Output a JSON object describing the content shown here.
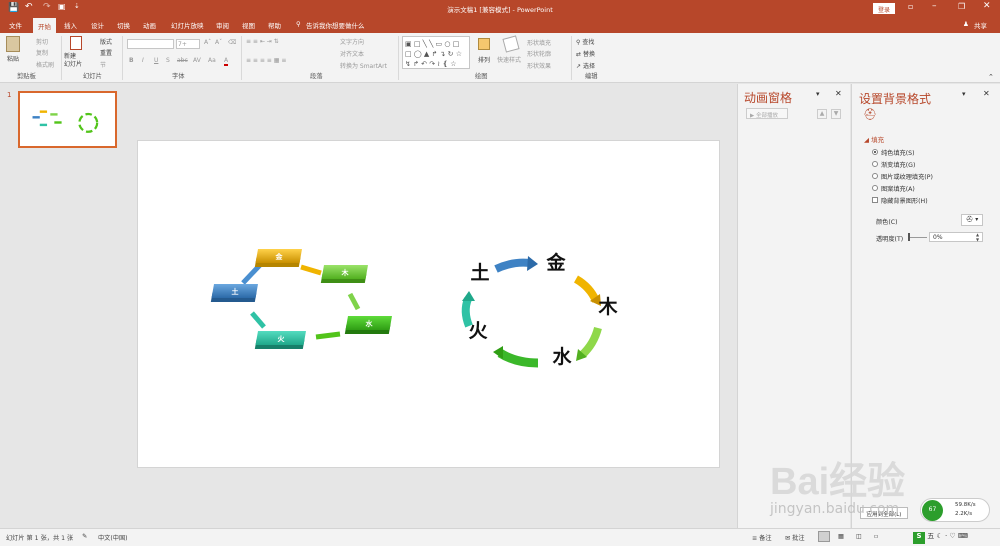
{
  "titlebar": {
    "title": "演示文稿1 [兼容模式]  -  PowerPoint",
    "login": "登录",
    "quick_access": [
      "save-icon",
      "undo-icon",
      "redo-icon",
      "start-from-beginning-icon",
      "customize-icon"
    ],
    "window_controls": [
      "ribbon-display-icon",
      "minimize-icon",
      "restore-icon",
      "close-icon"
    ]
  },
  "tabs": [
    "文件",
    "开始",
    "插入",
    "设计",
    "切换",
    "动画",
    "幻灯片放映",
    "审阅",
    "视图",
    "帮助"
  ],
  "active_tab": "开始",
  "tell_me": "告诉我你想要做什么",
  "share": "共享",
  "ribbon": {
    "clipboard": {
      "paste": "粘贴",
      "cut": "剪切",
      "copy": "复制",
      "format_painter": "格式刷",
      "group": "剪贴板"
    },
    "slides": {
      "new_slide": "新建\n幻灯片",
      "layout": "版式",
      "reset": "重置",
      "section": "节",
      "group": "幻灯片"
    },
    "font": {
      "size": "7+",
      "buttons": [
        "B",
        "I",
        "U",
        "S",
        "abc",
        "AV",
        "Aa",
        "A"
      ],
      "group": "字体"
    },
    "paragraph": {
      "text_direction": "文字方向",
      "align_text": "对齐文本",
      "smartart": "转换为 SmartArt",
      "group": "段落"
    },
    "drawing": {
      "arrange": "排列",
      "quick_styles": "快速样式",
      "shape_fill": "形状填充",
      "shape_outline": "形状轮廓",
      "shape_effects": "形状效果",
      "group": "绘图"
    },
    "editing": {
      "find": "查找",
      "replace": "替换",
      "select": "选择",
      "group": "编辑"
    }
  },
  "thumbnails": {
    "number": "1"
  },
  "slide": {
    "left_diagram": [
      "金",
      "土",
      "木",
      "火",
      "水"
    ],
    "right_cycle": [
      "金",
      "木",
      "水",
      "火",
      "土"
    ]
  },
  "animation_pane": {
    "title": "动画窗格",
    "play_all": "全部播放"
  },
  "format_background": {
    "title": "设置背景格式",
    "section": "填充",
    "options": [
      "纯色填充(S)",
      "渐变填充(G)",
      "图片或纹理填充(P)",
      "图案填充(A)"
    ],
    "selected": "纯色填充(S)",
    "hide_graphics": "隐藏背景图形(H)",
    "color_label": "颜色(C)",
    "transparency_label": "透明度(T)",
    "transparency_value": "0%",
    "apply_all": "应用到全部(L)"
  },
  "statusbar": {
    "slide_info": "幻灯片 第 1 张，共 1 张",
    "language": "中文(中国)",
    "notes": "备注",
    "comments": "批注",
    "net_up": "59.8K/s",
    "net_down": "2.2K/s"
  },
  "watermark": {
    "brand": "Bai经验",
    "url": "jingyan.baidu.com"
  },
  "colors": {
    "accent": "#b7472a",
    "gold": "#f0b400",
    "green": "#52c41a",
    "blue": "#3e82c4",
    "teal": "#2fc2a5"
  }
}
